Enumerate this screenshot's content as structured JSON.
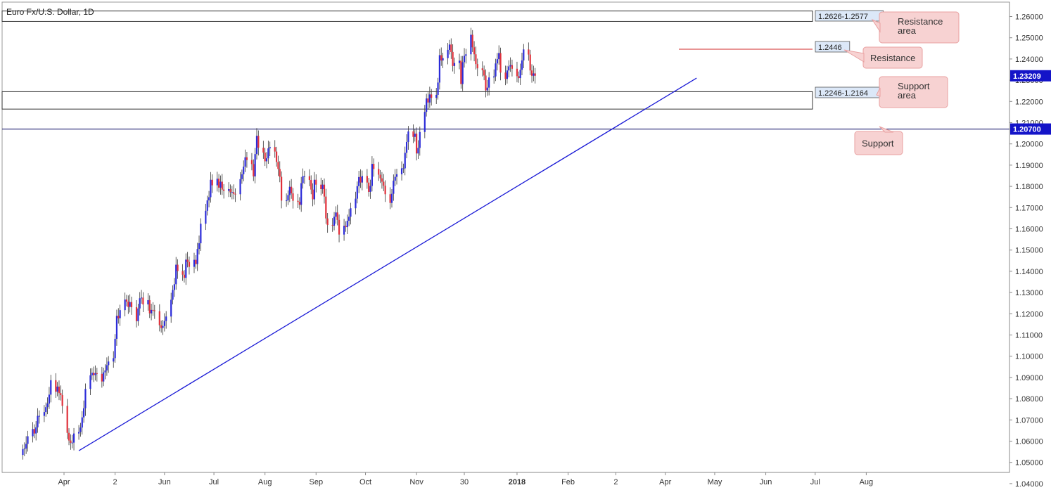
{
  "chart_title": "Euro Fx/U.S. Dollar, 1D",
  "colors": {
    "bull_candle": "#2b2bd8",
    "bear_candle": "#e0303a",
    "wick": "#333333",
    "trendline": "#1a1ad6",
    "resistance_line": "#e07070",
    "callout_fill": "#f7d2d2",
    "callout_stroke": "#e8a0a0",
    "level_label_fill": "#dce8f8",
    "price_badge": "#1414c8"
  },
  "chart_data": {
    "type": "candlestick",
    "x_tick_labels": [
      "Apr",
      "2",
      "Jun",
      "Jul",
      "Aug",
      "Sep",
      "Oct",
      "Nov",
      "30",
      "2018",
      "Feb",
      "2",
      "Apr",
      "May",
      "Jun",
      "Jul",
      "Aug"
    ],
    "y_tick_labels": [
      "1.26000",
      "1.25000",
      "1.24000",
      "1.23000",
      "1.22000",
      "1.21000",
      "1.20000",
      "1.19000",
      "1.18000",
      "1.17000",
      "1.16000",
      "1.15000",
      "1.14000",
      "1.13000",
      "1.12000",
      "1.11000",
      "1.10000",
      "1.09000",
      "1.08000",
      "1.07000",
      "1.06000",
      "1.05000",
      "1.04000"
    ],
    "y_range": [
      1.035,
      1.264
    ],
    "current_price": "1.23209",
    "support_level_label": "1.20700",
    "support_level": 1.207,
    "resistance_area": {
      "label": "1.2626-1.2577",
      "top": 1.2626,
      "bottom": 1.2577
    },
    "support_area": {
      "label": "1.2246-1.2164",
      "top": 1.2246,
      "bottom": 1.2164
    },
    "resistance_level": {
      "label": "1.2446",
      "value": 1.2446
    },
    "annotations": [
      {
        "text": "Resistance area"
      },
      {
        "text": "Resistance"
      },
      {
        "text": "Support area"
      },
      {
        "text": "Support"
      }
    ],
    "trendline": [
      {
        "date": "2017-04-10",
        "price": 1.0555
      },
      {
        "date": "2018-04-20",
        "price": 1.231
      }
    ],
    "closes": [
      1.0562,
      1.0565,
      1.0587,
      1.0623,
      1.0657,
      1.0636,
      1.0665,
      1.0719,
      1.0719,
      1.0737,
      1.076,
      1.0777,
      1.0819,
      1.0887,
      1.0833,
      1.0857,
      1.0826,
      1.0817,
      1.0766,
      1.0639,
      1.0603,
      1.0592,
      1.0593,
      1.0636,
      1.0643,
      1.0664,
      1.0712,
      1.0755,
      1.0846,
      1.091,
      1.0922,
      1.0911,
      1.092,
      1.0917,
      1.0881,
      1.0924,
      1.0933,
      1.0958,
      1.0975,
      1.0991,
      1.1082,
      1.119,
      1.1179,
      1.1217,
      1.1267,
      1.1257,
      1.1232,
      1.1255,
      1.1231,
      1.1165,
      1.1225,
      1.1273,
      1.1276,
      1.1244,
      1.1264,
      1.1202,
      1.1218,
      1.1216,
      1.1212,
      1.1146,
      1.1133,
      1.1142,
      1.1166,
      1.1187,
      1.1266,
      1.1312,
      1.1339,
      1.1431,
      1.1401,
      1.1384,
      1.1369,
      1.1455,
      1.1444,
      1.1421,
      1.1454,
      1.1434,
      1.1505,
      1.1532,
      1.1624,
      1.1685,
      1.1734,
      1.1749,
      1.1831,
      1.1805,
      1.1836,
      1.1794,
      1.1822,
      1.1785,
      1.1779,
      1.1787,
      1.1772,
      1.1773,
      1.1765,
      1.1763,
      1.1834,
      1.1857,
      1.1893,
      1.1937,
      1.1924,
      1.1905,
      1.1847,
      1.1952,
      1.2038,
      1.1982,
      1.1959,
      1.1918,
      1.1932,
      1.1979,
      1.1985,
      1.1964,
      1.1915,
      1.1882,
      1.1845,
      1.1733,
      1.1734,
      1.1759,
      1.1798,
      1.1767,
      1.1732,
      1.1727,
      1.1713,
      1.1815,
      1.1848,
      1.1848,
      1.183,
      1.1785,
      1.1739,
      1.1831,
      1.1808,
      1.1787,
      1.1808,
      1.1752,
      1.1649,
      1.1618,
      1.1615,
      1.1657,
      1.1677,
      1.1642,
      1.1573,
      1.1614,
      1.1608,
      1.1638,
      1.1657,
      1.1697,
      1.1742,
      1.1801,
      1.1844,
      1.1818,
      1.1849,
      1.1818,
      1.1774,
      1.1802,
      1.1906,
      1.1882,
      1.1855,
      1.1838,
      1.1822,
      1.1803,
      1.1763,
      1.1722,
      1.1765,
      1.1827,
      1.1845,
      1.1857,
      1.1885,
      1.1885,
      1.1958,
      1.2009,
      1.2059,
      1.2033,
      1.2048,
      1.1955,
      1.1981,
      1.2056,
      1.2151,
      1.2214,
      1.2195,
      1.2233,
      1.2217,
      1.2231,
      1.2289,
      1.2418,
      1.2393,
      1.2404,
      1.2443,
      1.2468,
      1.2433,
      1.2367,
      1.2381,
      1.2392,
      1.2282,
      1.2385,
      1.2415,
      1.2422,
      1.2514,
      1.2455,
      1.2422,
      1.2376,
      1.2356,
      1.2347,
      1.2322,
      1.2252,
      1.2265,
      1.2313,
      1.2318,
      1.2379,
      1.2399,
      1.2428,
      1.2336,
      1.2306,
      1.2346,
      1.2365,
      1.2371,
      1.2354,
      1.2319,
      1.231,
      1.2349,
      1.2393,
      1.2445,
      1.2421,
      1.2346,
      1.2321,
      1.2332,
      1.2321
    ]
  }
}
